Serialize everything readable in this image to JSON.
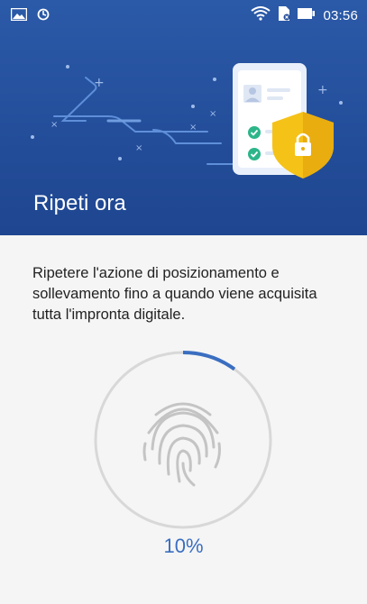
{
  "status_bar": {
    "time": "03:56",
    "icons": [
      "image-icon",
      "sync-icon",
      "wifi-icon",
      "sim-icon",
      "battery-icon"
    ]
  },
  "header": {
    "title": "Ripeti ora",
    "colors": {
      "background": "#2b5aa8",
      "shield": "#f5c218",
      "check": "#2db58a"
    }
  },
  "instruction": {
    "text": "Ripetere l'azione di posizionamento e sollevamento fino a quando viene acquisita tutta l'impronta digitale."
  },
  "progress": {
    "value": 0.1,
    "label": "10%",
    "color": "#3a6ec0",
    "track_color": "#d8d8d8"
  }
}
